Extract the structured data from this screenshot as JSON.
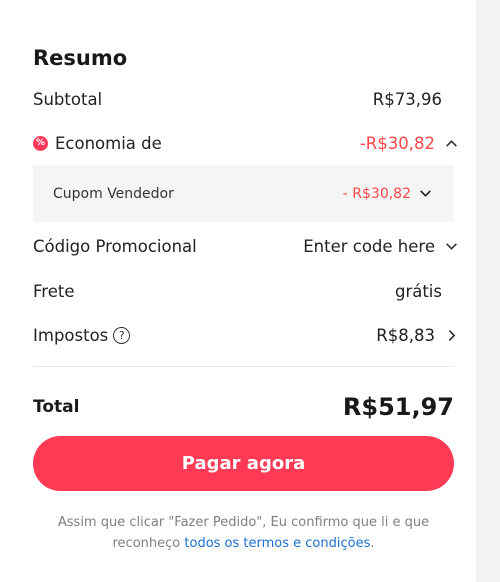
{
  "summary": {
    "title": "Resumo",
    "subtotal": {
      "label": "Subtotal",
      "value": "R$73,96"
    },
    "savings": {
      "label": "Economia de",
      "value": "-R$30,82",
      "icon": "savings-badge-icon",
      "expanded": true
    },
    "seller_coupon": {
      "label": "Cupom Vendedor",
      "value": "- R$30,82"
    },
    "promo_code": {
      "label": "Código Promocional",
      "value": "Enter code here"
    },
    "shipping": {
      "label": "Frete",
      "value": "grátis"
    },
    "taxes": {
      "label": "Impostos",
      "help_glyph": "?",
      "value": "R$8,83"
    },
    "total": {
      "label": "Total",
      "value": "R$51,97"
    },
    "pay_button": "Pagar agora",
    "disclaimer": {
      "text": "Assim que clicar \"Fazer Pedido\", Eu confirmo que li e que reconheço",
      "link": "todos os termos e condições",
      "end": "."
    }
  },
  "colors": {
    "accent": "#fe3a55",
    "discount": "#ff4747",
    "link": "#1b6fd1",
    "muted": "#808080"
  }
}
